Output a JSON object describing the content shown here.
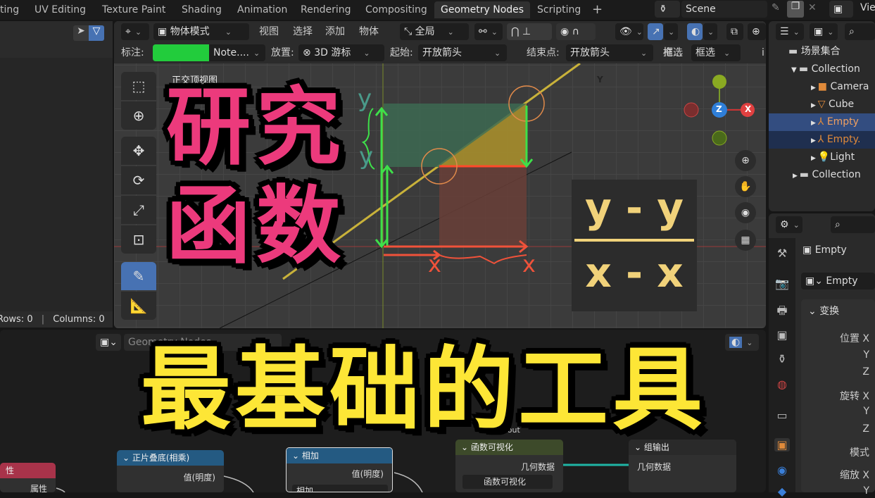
{
  "workspace_tabs": [
    {
      "label": "ting"
    },
    {
      "label": "UV Editing"
    },
    {
      "label": "Texture Paint"
    },
    {
      "label": "Shading"
    },
    {
      "label": "Animation"
    },
    {
      "label": "Rendering"
    },
    {
      "label": "Compositing"
    },
    {
      "label": "Geometry Nodes",
      "active": true
    },
    {
      "label": "Scripting"
    },
    {
      "label": "+"
    }
  ],
  "scene": {
    "name": "Scene",
    "view_layer": "Vie"
  },
  "viewport": {
    "mode": "物体模式",
    "menus": [
      "视图",
      "选择",
      "添加",
      "物体"
    ],
    "transform_orientation": "全局",
    "tool_settings": {
      "annotate_label": "标注:",
      "annotate_color": "#22cc3c",
      "note": "Note....",
      "placement_label": "放置:",
      "placement": "3D 游标",
      "start_label": "起始:",
      "start": "开放箭头",
      "end_label": "结束点:",
      "end": "开放箭头",
      "drag_label": "拖...",
      "drag": "框选",
      "more": "i"
    },
    "view_name": "正交顶视图",
    "gizmo": {
      "y": "Y",
      "z": "Z",
      "x": "X"
    },
    "annotations": {
      "y1": "y",
      "y2": "y",
      "x1": "x",
      "x2": "x"
    },
    "formula": {
      "numerator": "y - y",
      "denominator": "x - x"
    }
  },
  "spreadsheet": {
    "rows": "Rows: 0",
    "columns": "Columns: 0"
  },
  "overlay": {
    "line1": "研究",
    "line2": "函数",
    "line3": "最基础的工具"
  },
  "outliner": {
    "root": "场景集合",
    "items": [
      {
        "label": "Collection",
        "level": 1
      },
      {
        "label": "Camera",
        "level": 2
      },
      {
        "label": "Cube",
        "level": 2
      },
      {
        "label": "Empty",
        "level": 2,
        "selected": true
      },
      {
        "label": "Empty.",
        "level": 2
      },
      {
        "label": "Light",
        "level": 2
      },
      {
        "label": "Collection",
        "level": 1
      }
    ]
  },
  "properties": {
    "object_name": "Empty",
    "data_name": "Empty",
    "section": "变换",
    "fields": [
      "位置 X",
      "Y",
      "Z",
      "旋转 X",
      "Y",
      "Z",
      "模式",
      "缩放 X",
      "Y"
    ]
  },
  "node_editor": {
    "tree_name": "Geometry Nodes",
    "nodes": [
      {
        "title": "性",
        "socket": "属性"
      },
      {
        "title": "正片叠底(相乘)",
        "socket": "值(明度)"
      },
      {
        "title": "相加",
        "socket": "值(明度)",
        "field": "相加"
      },
      {
        "title": "函数可视化",
        "socket": "几何数据",
        "field": "函数可视化",
        "frame_label": "lame out"
      },
      {
        "title": "组输出",
        "socket": "几何数据"
      }
    ]
  },
  "colors": {
    "accent": "#4772b3",
    "green": "#22cc3c",
    "pink": "#ec3a7c",
    "yellow": "#fde636"
  }
}
